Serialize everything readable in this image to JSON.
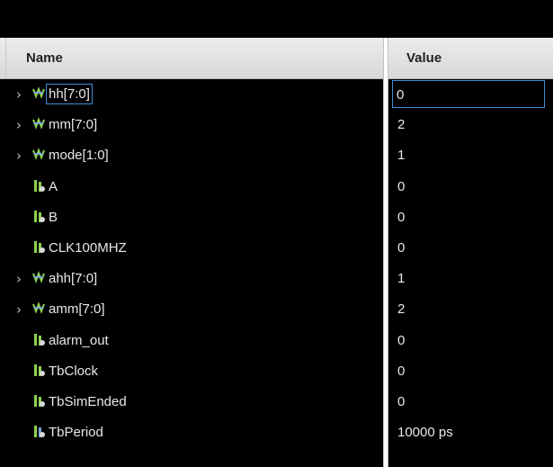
{
  "header": {
    "name_label": "Name",
    "value_label": "Value"
  },
  "rows": [
    {
      "name": "hh[7:0]",
      "value": "0",
      "kind": "bus",
      "expandable": true,
      "icon": "bus-signal-icon",
      "selected": true
    },
    {
      "name": "mm[7:0]",
      "value": "2",
      "kind": "bus",
      "expandable": true,
      "icon": "bus-signal-icon"
    },
    {
      "name": "mode[1:0]",
      "value": "1",
      "kind": "bus",
      "expandable": true,
      "icon": "bus-signal-icon"
    },
    {
      "name": "A",
      "value": "0",
      "kind": "bit",
      "expandable": false,
      "icon": "bit-signal-icon"
    },
    {
      "name": "B",
      "value": "0",
      "kind": "bit",
      "expandable": false,
      "icon": "bit-signal-icon"
    },
    {
      "name": "CLK100MHZ",
      "value": "0",
      "kind": "bit",
      "expandable": false,
      "icon": "bit-signal-icon"
    },
    {
      "name": "ahh[7:0]",
      "value": "1",
      "kind": "bus",
      "expandable": true,
      "icon": "bus-signal-icon"
    },
    {
      "name": "amm[7:0]",
      "value": "2",
      "kind": "bus",
      "expandable": true,
      "icon": "bus-signal-icon"
    },
    {
      "name": "alarm_out",
      "value": "0",
      "kind": "bit",
      "expandable": false,
      "icon": "bit-signal-icon"
    },
    {
      "name": "TbClock",
      "value": "0",
      "kind": "bit",
      "expandable": false,
      "icon": "bit-signal-icon"
    },
    {
      "name": "TbSimEnded",
      "value": "0",
      "kind": "bit",
      "expandable": false,
      "icon": "bit-signal-icon"
    },
    {
      "name": "TbPeriod",
      "value": "10000 ps",
      "kind": "param",
      "expandable": false,
      "icon": "parameter-icon"
    }
  ],
  "colors": {
    "background": "#000000",
    "text": "#e8e8e8",
    "icon_green": "#8fd14f",
    "icon_blue": "#7a9fd8",
    "selection": "#3d8ed8"
  }
}
